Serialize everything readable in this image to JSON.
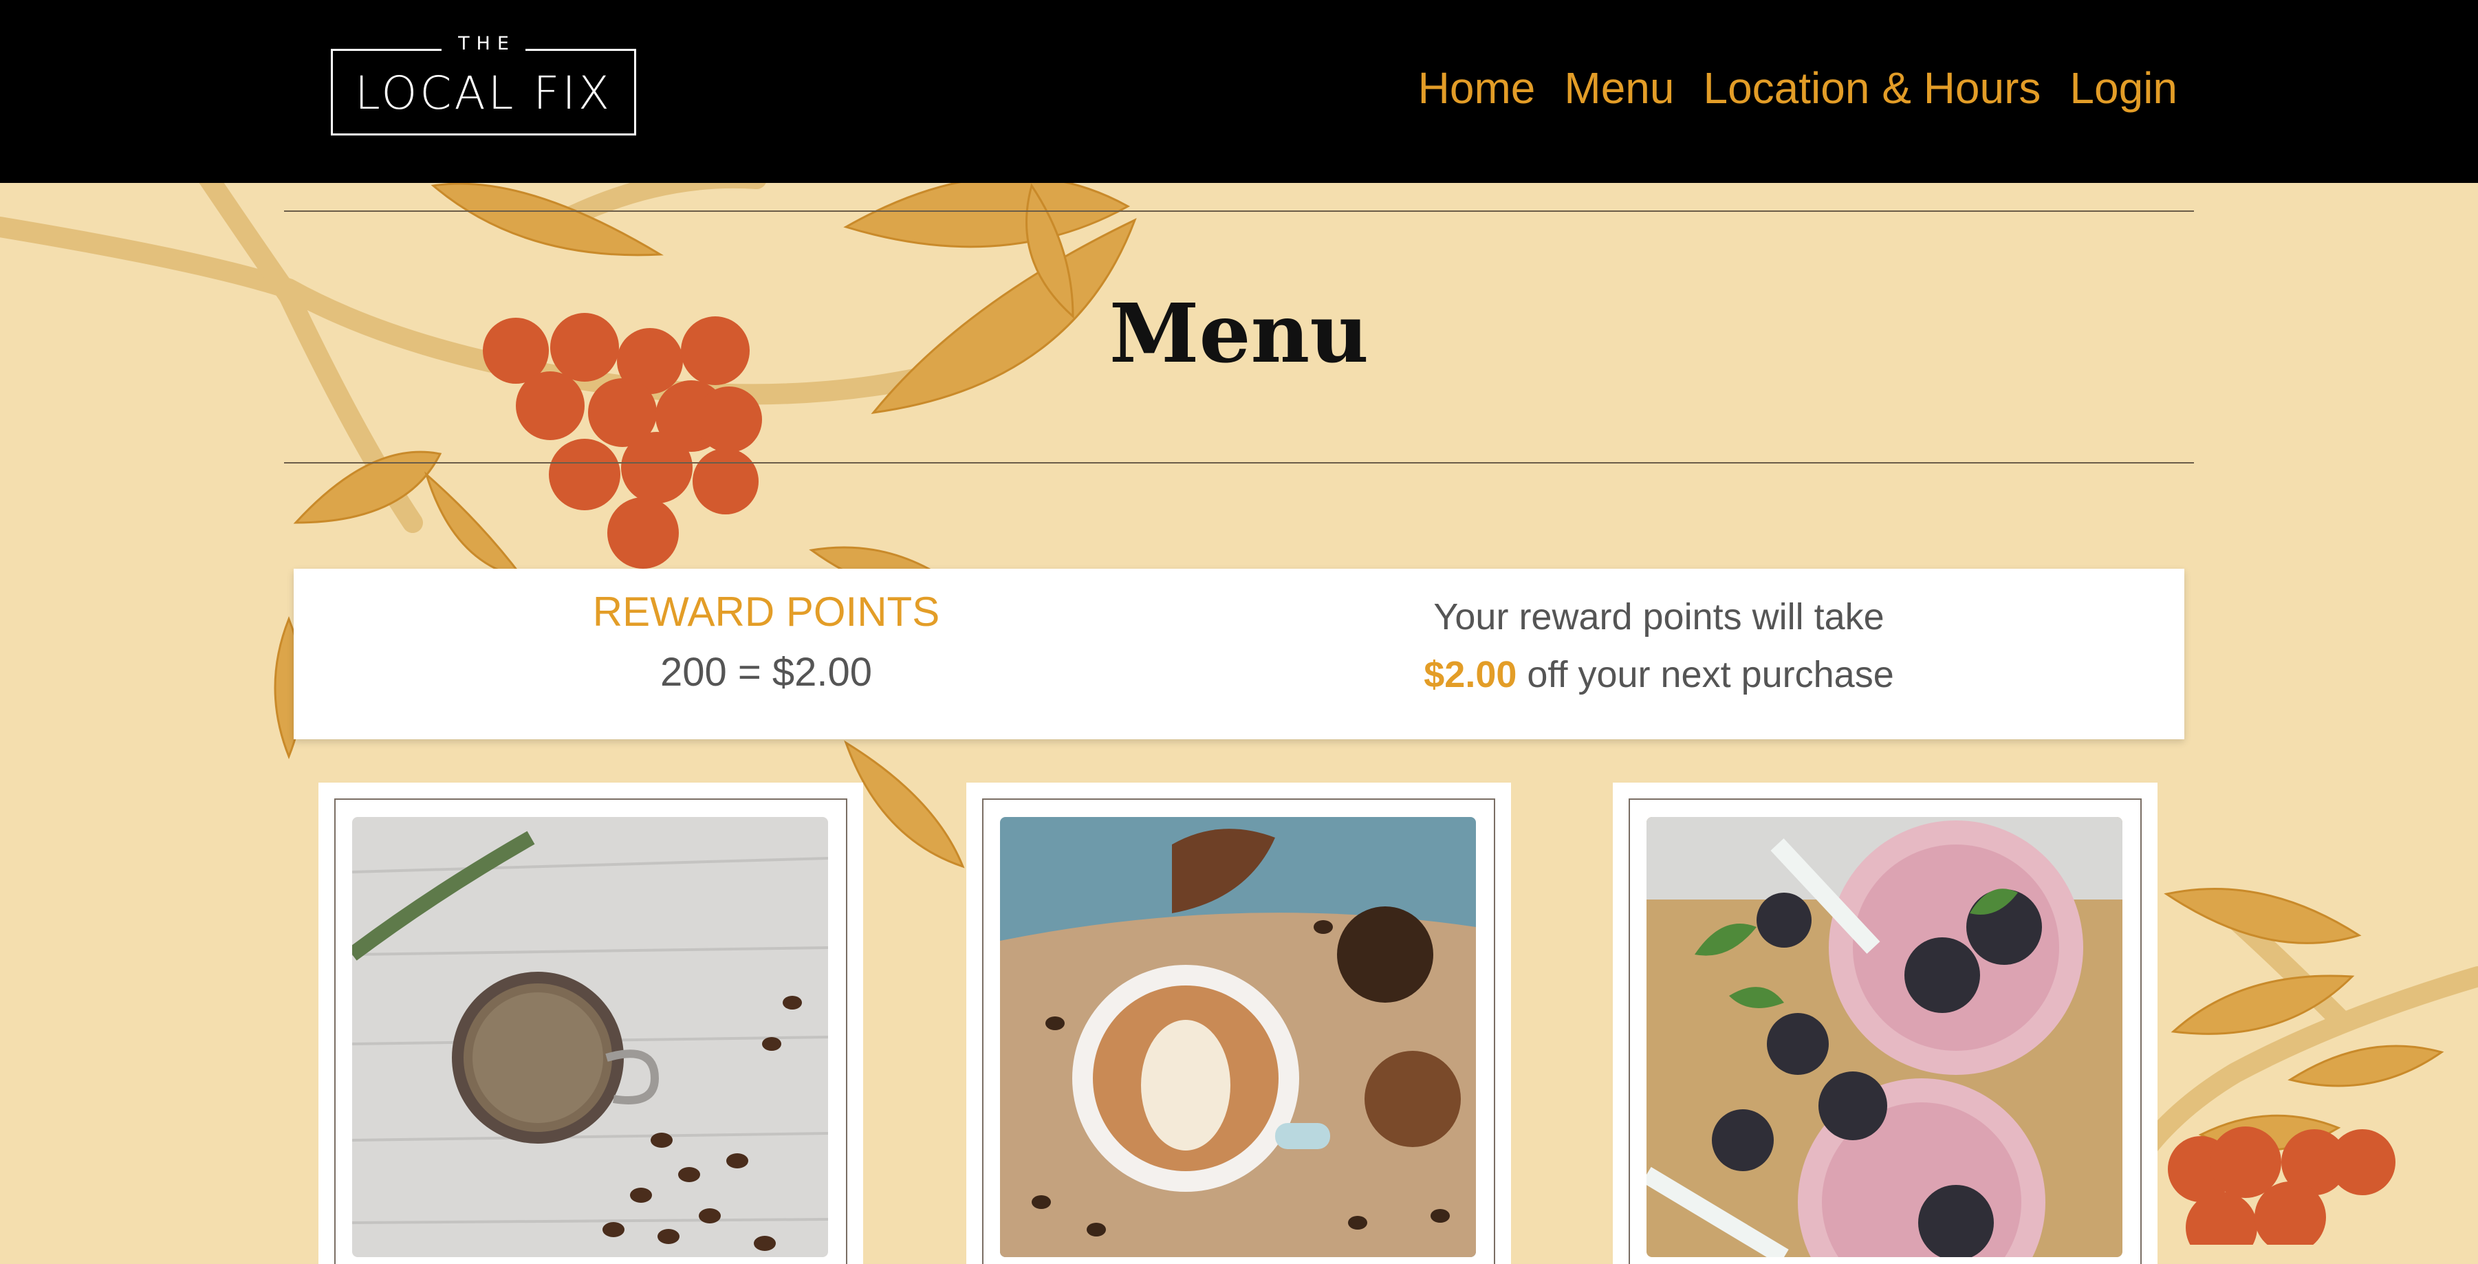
{
  "header": {
    "logo": {
      "small": "THE",
      "main": "LOCAL FIX"
    },
    "nav": [
      "Home",
      "Menu",
      "Location & Hours",
      "Login"
    ]
  },
  "page": {
    "title": "Menu"
  },
  "reward": {
    "title": "REWARD POINTS",
    "value": "200 = $2.00",
    "line1": "Your reward points will take",
    "amount": "$2.00",
    "line2_rest": " off your next purchase"
  },
  "menu_items": [
    {
      "image": "espresso-cup-photo"
    },
    {
      "image": "latte-art-photo"
    },
    {
      "image": "berry-smoothie-photo"
    }
  ],
  "colors": {
    "accent": "#e39d27",
    "background": "#f4deae",
    "header": "#000000",
    "berry": "#d35a2e"
  }
}
